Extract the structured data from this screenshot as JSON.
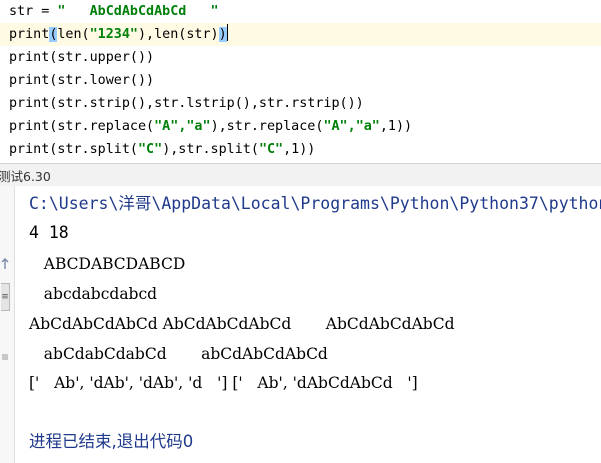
{
  "editor": {
    "lines": [
      {
        "pre": "str = ",
        "str": "\"   AbCdAbCdAbCd   \"",
        "post": ""
      },
      {
        "print": "print",
        "lparen": "(",
        "rest": "len(",
        "str": "\"1234\"",
        "post": "),len(str)",
        "rparen": ")"
      },
      {
        "text": "print(str.upper())"
      },
      {
        "text": "print(str.lower())"
      },
      {
        "text": "print(str.strip(),str.lstrip(),str.rstrip())"
      },
      {
        "pre": "print(str.replace(",
        "s1": "\"A\"",
        "c1": ",",
        "s2": "\"a\"",
        "mid": "),str.replace(",
        "s3": "\"A\"",
        "c2": ",",
        "s4": "\"a\"",
        "post": ",1))"
      },
      {
        "pre": "print(str.split(",
        "s1": "\"C\"",
        "mid": "),str.split(",
        "s2": "\"C\"",
        "post": ",1))"
      }
    ]
  },
  "run_tab": {
    "label": "测试6.30"
  },
  "console": {
    "lines": [
      "C:\\Users\\洋哥\\AppData\\Local\\Programs\\Python\\Python37\\python",
      "4 18",
      "   ABCDABCDABCD",
      "   abcdabcdabcd",
      "AbCdAbCdAbCd AbCdAbCdAbCd       AbCdAbCdAbCd",
      "   abCdabCdabCd       abCdAbCdAbCd",
      "['   Ab', 'dAb', 'dAb', 'd   '] ['   Ab', 'dAbCdAbCd   ']",
      "",
      "进程已结束,退出代码0"
    ]
  },
  "colors": {
    "string_literal": "#00800a",
    "console_path": "#1f3a8c",
    "current_line": "#fffae3",
    "bracket_match": "#99ccff"
  }
}
